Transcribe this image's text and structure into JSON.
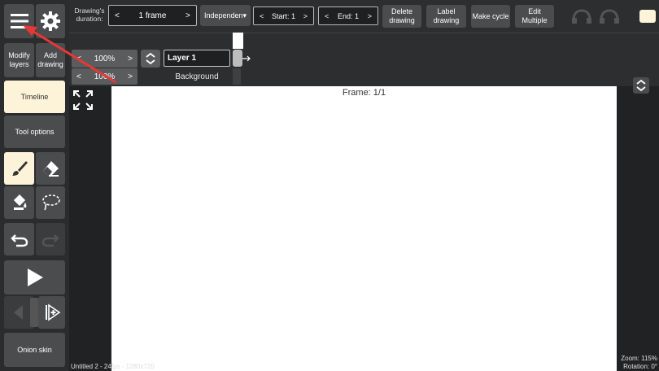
{
  "toolbar": {
    "drawing_duration_label": "Drawing's duration:",
    "frame_prev": "<",
    "frame_value": "1 frame",
    "frame_next": ">",
    "independent": "Independen▾",
    "start_prev": "<",
    "start_label": "Start: 1",
    "start_next": ">",
    "end_prev": "<",
    "end_label": "End: 1",
    "end_next": ">",
    "delete_drawing": "Delete drawing",
    "label_drawing": "Label drawing",
    "make_cycle": "Make cycle",
    "edit_multiple": "Edit Multiple"
  },
  "sidebar": {
    "modify_layers": "Modify layers",
    "add_drawing": "Add drawing",
    "timeline": "Timeline",
    "tool_options": "Tool options",
    "onion_skin": "Onion skin"
  },
  "layers": {
    "zoom1_prev": "<",
    "zoom1_value": "100%",
    "zoom1_next": ">",
    "zoom2_prev": "<",
    "zoom2_value": "100%",
    "zoom2_next": ">",
    "layer1_name": "Layer 1",
    "background_name": "Background"
  },
  "canvas": {
    "frame_label": "Frame: 1/1"
  },
  "status": {
    "file_info": "Untitled 2 - 24fps - 1280x720",
    "zoom": "Zoom: 115%",
    "rotation": "Rotation: 0°"
  },
  "colors": {
    "accent_active": "#fcf3d9",
    "arrow_red": "#e53935"
  }
}
